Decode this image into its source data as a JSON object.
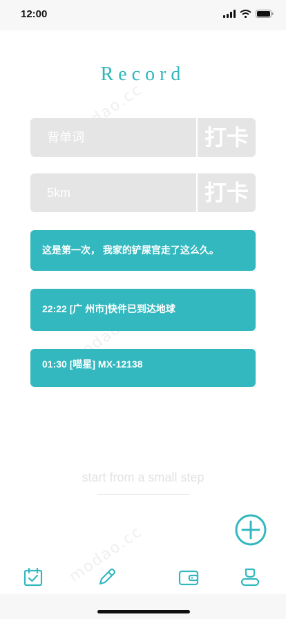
{
  "status_bar": {
    "time": "12:00"
  },
  "header": {
    "title": "Record"
  },
  "tasks": [
    {
      "name": "背单词",
      "button": "打卡"
    },
    {
      "name": "5km",
      "button": "打卡"
    }
  ],
  "records": [
    {
      "text": "这是第一次， 我家的铲屎官走了这么久。"
    },
    {
      "text": "22:22 [广 州市]快件已到达地球"
    },
    {
      "text": "01:30 [喵星] MX-12138"
    }
  ],
  "slogan": "start from a small step",
  "watermark": "modao.cc",
  "colors": {
    "accent": "#33b8bf",
    "task_bg": "#e5e5e5"
  },
  "tabs": [
    {
      "icon": "calendar-check-icon"
    },
    {
      "icon": "pencil-icon"
    },
    {
      "icon": "wallet-icon"
    },
    {
      "icon": "profile-icon"
    }
  ]
}
